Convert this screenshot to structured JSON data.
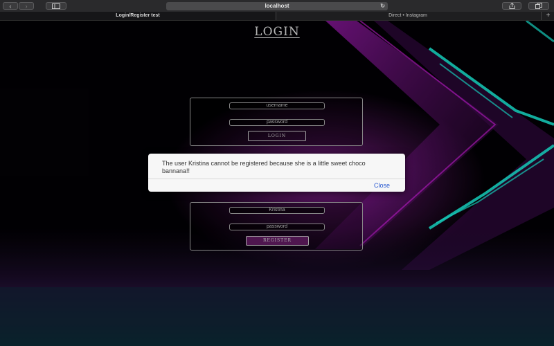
{
  "browser": {
    "url": "localhost",
    "back_icon": "chevron-left-icon",
    "forward_icon": "chevron-right-icon",
    "tabs": [
      {
        "label": "Login/Register test",
        "active": true
      },
      {
        "label": "Direct • Instagram",
        "active": false
      }
    ],
    "new_tab_label": "+"
  },
  "login": {
    "title": "LOGIN",
    "username_placeholder": "username",
    "password_placeholder": "password",
    "button_label": "LOGIN"
  },
  "register": {
    "username_value": "Kristina",
    "password_placeholder": "password",
    "button_label": "REGISTER",
    "button_color": "#5a1a5a"
  },
  "alert": {
    "message": "The user Kristina cannot be registered because she is a little sweet choco bannana!!",
    "close_label": "Close",
    "close_color": "#2a5ad2"
  },
  "theme": {
    "neon_cyan": "#19e6d2",
    "neon_magenta": "#d21ee0"
  }
}
